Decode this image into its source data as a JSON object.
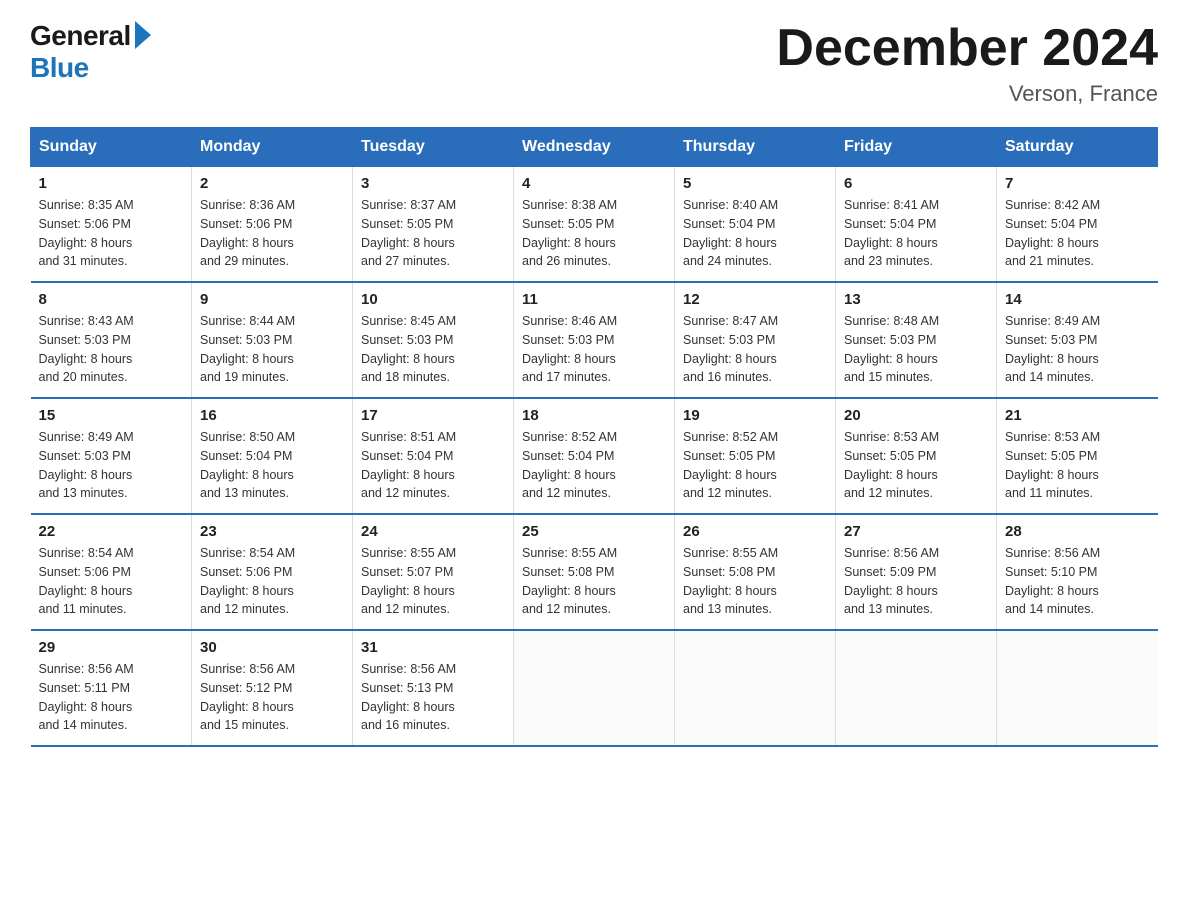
{
  "logo": {
    "general": "General",
    "blue": "Blue"
  },
  "title": "December 2024",
  "location": "Verson, France",
  "days_of_week": [
    "Sunday",
    "Monday",
    "Tuesday",
    "Wednesday",
    "Thursday",
    "Friday",
    "Saturday"
  ],
  "weeks": [
    [
      {
        "day": "1",
        "sunrise": "8:35 AM",
        "sunset": "5:06 PM",
        "daylight": "8 hours and 31 minutes."
      },
      {
        "day": "2",
        "sunrise": "8:36 AM",
        "sunset": "5:06 PM",
        "daylight": "8 hours and 29 minutes."
      },
      {
        "day": "3",
        "sunrise": "8:37 AM",
        "sunset": "5:05 PM",
        "daylight": "8 hours and 27 minutes."
      },
      {
        "day": "4",
        "sunrise": "8:38 AM",
        "sunset": "5:05 PM",
        "daylight": "8 hours and 26 minutes."
      },
      {
        "day": "5",
        "sunrise": "8:40 AM",
        "sunset": "5:04 PM",
        "daylight": "8 hours and 24 minutes."
      },
      {
        "day": "6",
        "sunrise": "8:41 AM",
        "sunset": "5:04 PM",
        "daylight": "8 hours and 23 minutes."
      },
      {
        "day": "7",
        "sunrise": "8:42 AM",
        "sunset": "5:04 PM",
        "daylight": "8 hours and 21 minutes."
      }
    ],
    [
      {
        "day": "8",
        "sunrise": "8:43 AM",
        "sunset": "5:03 PM",
        "daylight": "8 hours and 20 minutes."
      },
      {
        "day": "9",
        "sunrise": "8:44 AM",
        "sunset": "5:03 PM",
        "daylight": "8 hours and 19 minutes."
      },
      {
        "day": "10",
        "sunrise": "8:45 AM",
        "sunset": "5:03 PM",
        "daylight": "8 hours and 18 minutes."
      },
      {
        "day": "11",
        "sunrise": "8:46 AM",
        "sunset": "5:03 PM",
        "daylight": "8 hours and 17 minutes."
      },
      {
        "day": "12",
        "sunrise": "8:47 AM",
        "sunset": "5:03 PM",
        "daylight": "8 hours and 16 minutes."
      },
      {
        "day": "13",
        "sunrise": "8:48 AM",
        "sunset": "5:03 PM",
        "daylight": "8 hours and 15 minutes."
      },
      {
        "day": "14",
        "sunrise": "8:49 AM",
        "sunset": "5:03 PM",
        "daylight": "8 hours and 14 minutes."
      }
    ],
    [
      {
        "day": "15",
        "sunrise": "8:49 AM",
        "sunset": "5:03 PM",
        "daylight": "8 hours and 13 minutes."
      },
      {
        "day": "16",
        "sunrise": "8:50 AM",
        "sunset": "5:04 PM",
        "daylight": "8 hours and 13 minutes."
      },
      {
        "day": "17",
        "sunrise": "8:51 AM",
        "sunset": "5:04 PM",
        "daylight": "8 hours and 12 minutes."
      },
      {
        "day": "18",
        "sunrise": "8:52 AM",
        "sunset": "5:04 PM",
        "daylight": "8 hours and 12 minutes."
      },
      {
        "day": "19",
        "sunrise": "8:52 AM",
        "sunset": "5:05 PM",
        "daylight": "8 hours and 12 minutes."
      },
      {
        "day": "20",
        "sunrise": "8:53 AM",
        "sunset": "5:05 PM",
        "daylight": "8 hours and 12 minutes."
      },
      {
        "day": "21",
        "sunrise": "8:53 AM",
        "sunset": "5:05 PM",
        "daylight": "8 hours and 11 minutes."
      }
    ],
    [
      {
        "day": "22",
        "sunrise": "8:54 AM",
        "sunset": "5:06 PM",
        "daylight": "8 hours and 11 minutes."
      },
      {
        "day": "23",
        "sunrise": "8:54 AM",
        "sunset": "5:06 PM",
        "daylight": "8 hours and 12 minutes."
      },
      {
        "day": "24",
        "sunrise": "8:55 AM",
        "sunset": "5:07 PM",
        "daylight": "8 hours and 12 minutes."
      },
      {
        "day": "25",
        "sunrise": "8:55 AM",
        "sunset": "5:08 PM",
        "daylight": "8 hours and 12 minutes."
      },
      {
        "day": "26",
        "sunrise": "8:55 AM",
        "sunset": "5:08 PM",
        "daylight": "8 hours and 13 minutes."
      },
      {
        "day": "27",
        "sunrise": "8:56 AM",
        "sunset": "5:09 PM",
        "daylight": "8 hours and 13 minutes."
      },
      {
        "day": "28",
        "sunrise": "8:56 AM",
        "sunset": "5:10 PM",
        "daylight": "8 hours and 14 minutes."
      }
    ],
    [
      {
        "day": "29",
        "sunrise": "8:56 AM",
        "sunset": "5:11 PM",
        "daylight": "8 hours and 14 minutes."
      },
      {
        "day": "30",
        "sunrise": "8:56 AM",
        "sunset": "5:12 PM",
        "daylight": "8 hours and 15 minutes."
      },
      {
        "day": "31",
        "sunrise": "8:56 AM",
        "sunset": "5:13 PM",
        "daylight": "8 hours and 16 minutes."
      },
      null,
      null,
      null,
      null
    ]
  ],
  "labels": {
    "sunrise": "Sunrise:",
    "sunset": "Sunset:",
    "daylight": "Daylight:"
  }
}
